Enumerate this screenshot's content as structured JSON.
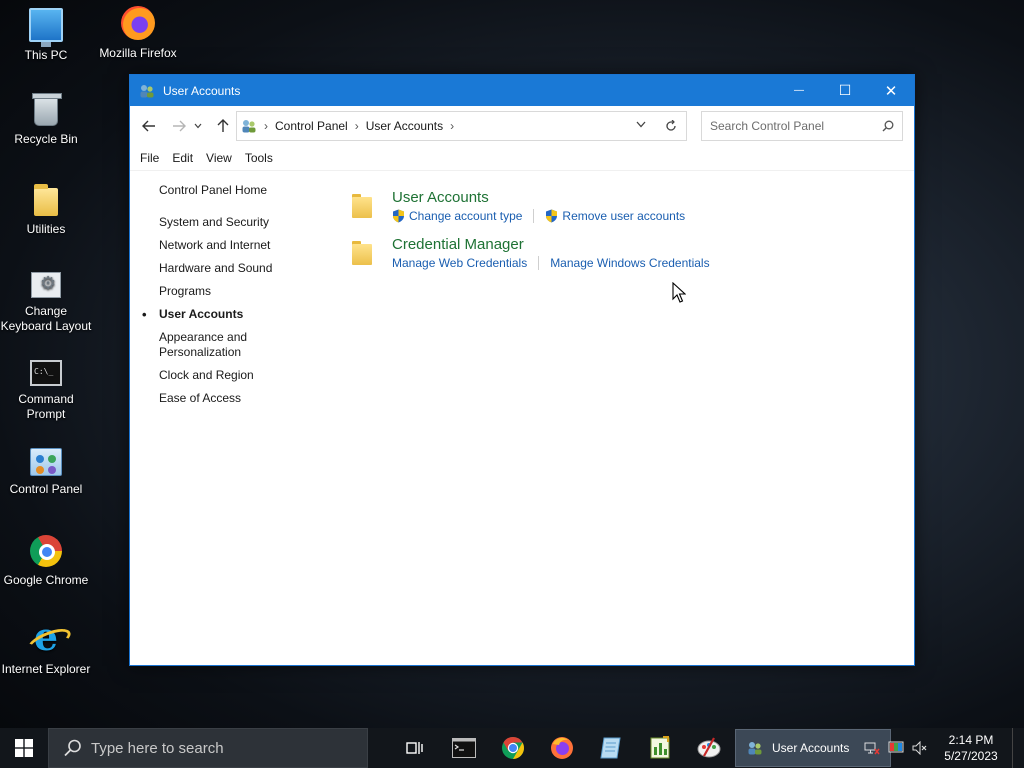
{
  "desktop": {
    "icons": [
      {
        "label": "This PC"
      },
      {
        "label": "Mozilla Firefox"
      },
      {
        "label": "Recycle Bin"
      },
      {
        "label": "Utilities"
      },
      {
        "label": "Change Keyboard Layout"
      },
      {
        "label": "Command Prompt"
      },
      {
        "label": "Control Panel"
      },
      {
        "label": "Google Chrome"
      },
      {
        "label": "Internet Explorer"
      }
    ]
  },
  "window": {
    "title": "User Accounts",
    "controls": {
      "minimize": "—",
      "maximize": "☐",
      "close": "✕"
    },
    "breadcrumb": [
      "Control Panel",
      "User Accounts"
    ],
    "search_placeholder": "Search Control Panel",
    "menu": [
      "File",
      "Edit",
      "View",
      "Tools"
    ]
  },
  "sidebar": {
    "home": "Control Panel Home",
    "items": [
      {
        "label": "System and Security"
      },
      {
        "label": "Network and Internet"
      },
      {
        "label": "Hardware and Sound"
      },
      {
        "label": "Programs"
      },
      {
        "label": "User Accounts"
      },
      {
        "label": "Appearance and Personalization"
      },
      {
        "label": "Clock and Region"
      },
      {
        "label": "Ease of Access"
      }
    ],
    "current_index": 4
  },
  "categories": [
    {
      "title": "User Accounts",
      "links": [
        {
          "label": "Change account type",
          "icon": "shield-icon"
        },
        {
          "label": "Remove user accounts",
          "icon": "shield-icon"
        }
      ]
    },
    {
      "title": "Credential Manager",
      "links": [
        {
          "label": "Manage Web Credentials"
        },
        {
          "label": "Manage Windows Credentials"
        }
      ]
    }
  ],
  "taskbar": {
    "search_placeholder": "Type here to search",
    "active_window": "User Accounts",
    "pinned": [
      "task-view-icon",
      "command-prompt-icon",
      "chrome-icon",
      "firefox-icon",
      "notepad-icon",
      "spreadsheet-icon",
      "paint-icon"
    ],
    "clock": {
      "time": "2:14 PM",
      "date": "5/27/2023"
    }
  },
  "colors": {
    "titlebar": "#1a79d6",
    "category_title": "#1e7234",
    "link": "#1a5eb0",
    "taskbar": "#12161b"
  }
}
